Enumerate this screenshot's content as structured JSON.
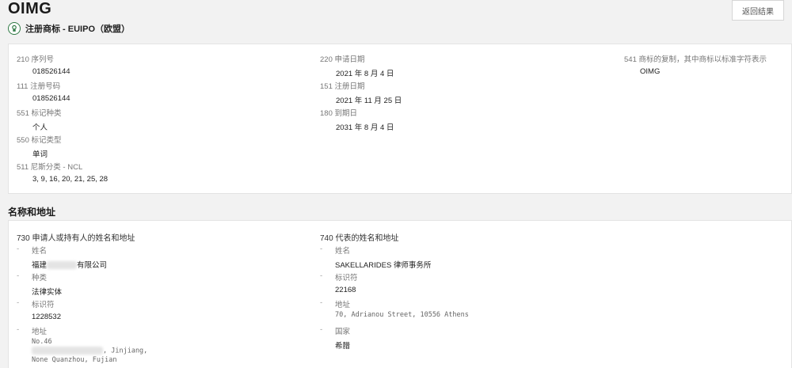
{
  "header": {
    "title": "OIMG",
    "back_label": "返回结果",
    "subtitle": "注册商标 - EUIPO（欧盟）"
  },
  "details": {
    "serial": {
      "label": "210  序列号",
      "value": "018526144"
    },
    "reg_no": {
      "label": "111  注册号码",
      "value": "018526144"
    },
    "mark_kind": {
      "label": "551  标记种类",
      "value": "个人"
    },
    "mark_type": {
      "label": "550  标记类型",
      "value": "单词"
    },
    "nice": {
      "label": "511  尼斯分类 - NCL",
      "value": "3, 9, 16, 20, 21, 25, 28"
    },
    "app_date": {
      "label": "220  申请日期",
      "value": "2021 年 8 月 4 日"
    },
    "reg_date": {
      "label": "151  注册日期",
      "value": "2021 年 11 月 25 日"
    },
    "expiry": {
      "label": "180  到期日",
      "value": "2031 年 8 月 4 日"
    },
    "repro": {
      "label": "541  商标的复制，其中商标以标准字符表示",
      "value": "OIMG"
    }
  },
  "names_section": {
    "title": "名称和地址",
    "applicant": {
      "heading": "730 申请人或持有人的姓名和地址",
      "name_label": "姓名",
      "name_prefix": "福建",
      "name_suffix": "有限公司",
      "kind_label": "种类",
      "kind_value": "法律实体",
      "id_label": "标识符",
      "id_value": "1228532",
      "addr_label": "地址",
      "addr_line1": "No.46",
      "addr_line2_suffix": ", Jinjiang,",
      "addr_line3": "None Quanzhou, Fujian"
    },
    "representative": {
      "heading": "740 代表的姓名和地址",
      "name_label": "姓名",
      "name_value": "SAKELLARIDES 律师事务所",
      "id_label": "标识符",
      "id_value": "22168",
      "addr_label": "地址",
      "addr_value": "70, Adrianou Street, 10556 Athens",
      "country_label": "国家",
      "country_value": "希腊"
    }
  },
  "colors": {
    "icon_green": "#2f7a45",
    "background": "#f2f2f2"
  }
}
